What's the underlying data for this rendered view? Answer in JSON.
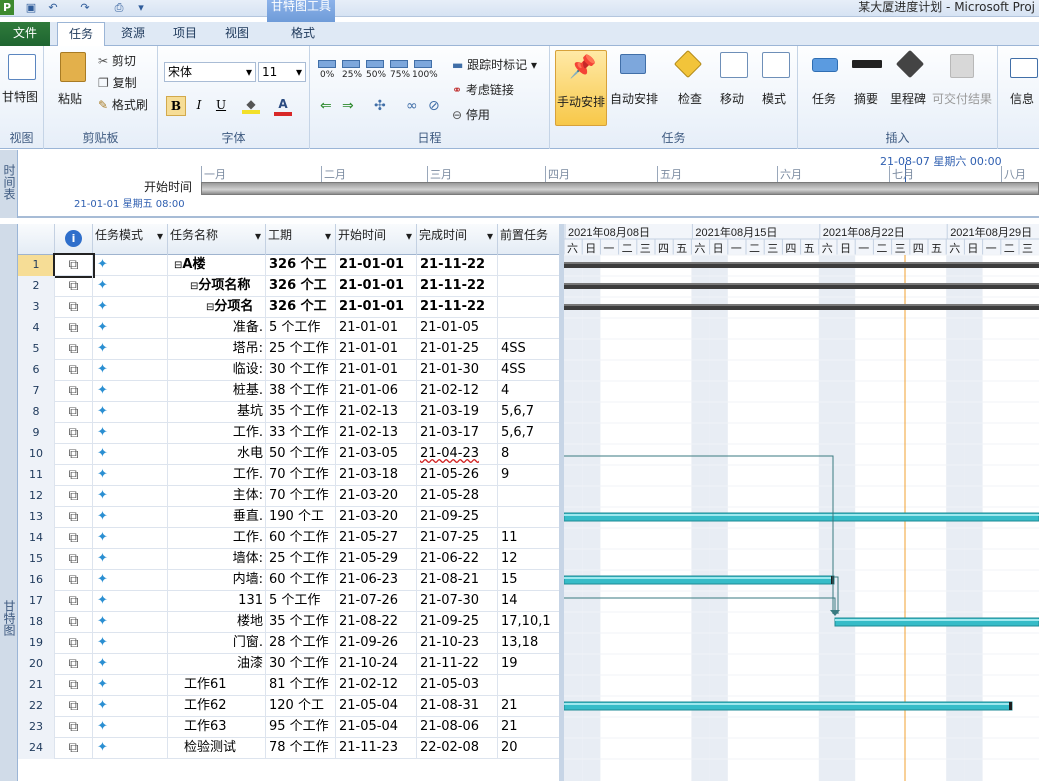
{
  "window": {
    "title": "某大厦进度计划 - Microsoft Proj",
    "context_group": "甘特图工具",
    "context_tab": "格式"
  },
  "tabs": [
    "文件",
    "任务",
    "资源",
    "项目",
    "视图"
  ],
  "ribbon": {
    "view": {
      "gantt": "甘特图",
      "label": "视图"
    },
    "clipboard": {
      "paste": "粘贴",
      "cut": "剪切",
      "copy": "复制",
      "format_painter": "格式刷",
      "label": "剪贴板"
    },
    "font": {
      "name": "宋体",
      "size": "11",
      "bold": "B",
      "italic": "I",
      "underline": "U",
      "label": "字体"
    },
    "schedule": {
      "pcts": [
        "0%",
        "25%",
        "50%",
        "75%",
        "100%"
      ],
      "track": "跟踪时标记",
      "respect": "考虑链接",
      "inactivate": "停用",
      "label": "日程"
    },
    "tasks": {
      "manual": "手动安排",
      "auto": "自动安排",
      "inspect": "检查",
      "move": "移动",
      "mode": "模式",
      "label": "任务"
    },
    "insert": {
      "task": "任务",
      "summary": "摘要",
      "milestone": "里程碑",
      "deliverable": "可交付结果",
      "label": "插入"
    },
    "properties": {
      "info": "信息"
    }
  },
  "timeline": {
    "side_label": "时间表",
    "start_label": "开始时间",
    "start_date": "21-01-01 星期五 08:00",
    "current": "21-08-07 星期六 00:00",
    "months": [
      "一月",
      "二月",
      "三月",
      "四月",
      "五月",
      "六月",
      "七月",
      "八月"
    ]
  },
  "gantt_side_label": "甘特图",
  "columns": [
    "任务模式",
    "任务名称",
    "工期",
    "开始时间",
    "完成时间",
    "前置任务"
  ],
  "chart_header": {
    "weeks": [
      "2021年08月08日",
      "2021年08月15日",
      "2021年08月22日",
      "2021年08月29日"
    ],
    "days": [
      "六",
      "日",
      "一",
      "二",
      "三",
      "四",
      "五",
      "六",
      "日",
      "一",
      "二",
      "三",
      "四",
      "五",
      "六",
      "日",
      "一",
      "二",
      "三",
      "四",
      "五",
      "六",
      "日",
      "一",
      "二",
      "三"
    ]
  },
  "rows": [
    {
      "n": "1",
      "name": "A楼",
      "dur": "326 个工",
      "start": "21-01-01",
      "finish": "21-11-22",
      "pred": "",
      "bold": true,
      "level": 0
    },
    {
      "n": "2",
      "name": "分项名称",
      "dur": "326 个工",
      "start": "21-01-01",
      "finish": "21-11-22",
      "pred": "",
      "bold": true,
      "level": 1
    },
    {
      "n": "3",
      "name": "分项名",
      "dur": "326 个工",
      "start": "21-01-01",
      "finish": "21-11-22",
      "pred": "",
      "bold": true,
      "level": 2
    },
    {
      "n": "4",
      "name": "准备.",
      "dur": "5 个工作",
      "start": "21-01-01",
      "finish": "21-01-05",
      "pred": "",
      "level": 3
    },
    {
      "n": "5",
      "name": "塔吊:",
      "dur": "25 个工作",
      "start": "21-01-01",
      "finish": "21-01-25",
      "pred": "4SS",
      "level": 3
    },
    {
      "n": "6",
      "name": "临设:",
      "dur": "30 个工作",
      "start": "21-01-01",
      "finish": "21-01-30",
      "pred": "4SS",
      "level": 3
    },
    {
      "n": "7",
      "name": "桩基.",
      "dur": "38 个工作",
      "start": "21-01-06",
      "finish": "21-02-12",
      "pred": "4",
      "level": 3
    },
    {
      "n": "8",
      "name": "基坑",
      "dur": "35 个工作",
      "start": "21-02-13",
      "finish": "21-03-19",
      "pred": "5,6,7",
      "level": 3
    },
    {
      "n": "9",
      "name": "工作.",
      "dur": "33 个工作",
      "start": "21-02-13",
      "finish": "21-03-17",
      "pred": "5,6,7",
      "level": 3
    },
    {
      "n": "10",
      "name": "水电",
      "dur": "50 个工作",
      "start": "21-03-05",
      "finish": "21-04-23",
      "pred": "8",
      "level": 3
    },
    {
      "n": "11",
      "name": "工作.",
      "dur": "70 个工作",
      "start": "21-03-18",
      "finish": "21-05-26",
      "pred": "9",
      "level": 3
    },
    {
      "n": "12",
      "name": "主体:",
      "dur": "70 个工作",
      "start": "21-03-20",
      "finish": "21-05-28",
      "pred": "",
      "level": 3
    },
    {
      "n": "13",
      "name": "垂直.",
      "dur": "190 个工",
      "start": "21-03-20",
      "finish": "21-09-25",
      "pred": "",
      "level": 3
    },
    {
      "n": "14",
      "name": "工作.",
      "dur": "60 个工作",
      "start": "21-05-27",
      "finish": "21-07-25",
      "pred": "11",
      "level": 3
    },
    {
      "n": "15",
      "name": "墙体:",
      "dur": "25 个工作",
      "start": "21-05-29",
      "finish": "21-06-22",
      "pred": "12",
      "level": 3
    },
    {
      "n": "16",
      "name": "内墙:",
      "dur": "60 个工作",
      "start": "21-06-23",
      "finish": "21-08-21",
      "pred": "15",
      "level": 3
    },
    {
      "n": "17",
      "name": "131",
      "dur": "5 个工作",
      "start": "21-07-26",
      "finish": "21-07-30",
      "pred": "14",
      "level": 3
    },
    {
      "n": "18",
      "name": "楼地",
      "dur": "35 个工作",
      "start": "21-08-22",
      "finish": "21-09-25",
      "pred": "17,10,1",
      "level": 3
    },
    {
      "n": "19",
      "name": "门窗.",
      "dur": "28 个工作",
      "start": "21-09-26",
      "finish": "21-10-23",
      "pred": "13,18",
      "level": 3
    },
    {
      "n": "20",
      "name": "油漆",
      "dur": "30 个工作",
      "start": "21-10-24",
      "finish": "21-11-22",
      "pred": "19",
      "level": 3
    },
    {
      "n": "21",
      "name": "工作61",
      "dur": "81 个工作",
      "start": "21-02-12",
      "finish": "21-05-03",
      "pred": "",
      "level": 4
    },
    {
      "n": "22",
      "name": "工作62",
      "dur": "120 个工",
      "start": "21-05-04",
      "finish": "21-08-31",
      "pred": "21",
      "level": 4
    },
    {
      "n": "23",
      "name": "工作63",
      "dur": "95 个工作",
      "start": "21-05-04",
      "finish": "21-08-06",
      "pred": "21",
      "level": 4
    },
    {
      "n": "24",
      "name": "检验测试",
      "dur": "78 个工作",
      "start": "21-11-23",
      "finish": "22-02-08",
      "pred": "20",
      "level": 4
    }
  ],
  "colors": {
    "bar": "#36bcc8",
    "summary": "#3c3c3c",
    "today": "#f0a030",
    "selected": "#f6dd96"
  }
}
